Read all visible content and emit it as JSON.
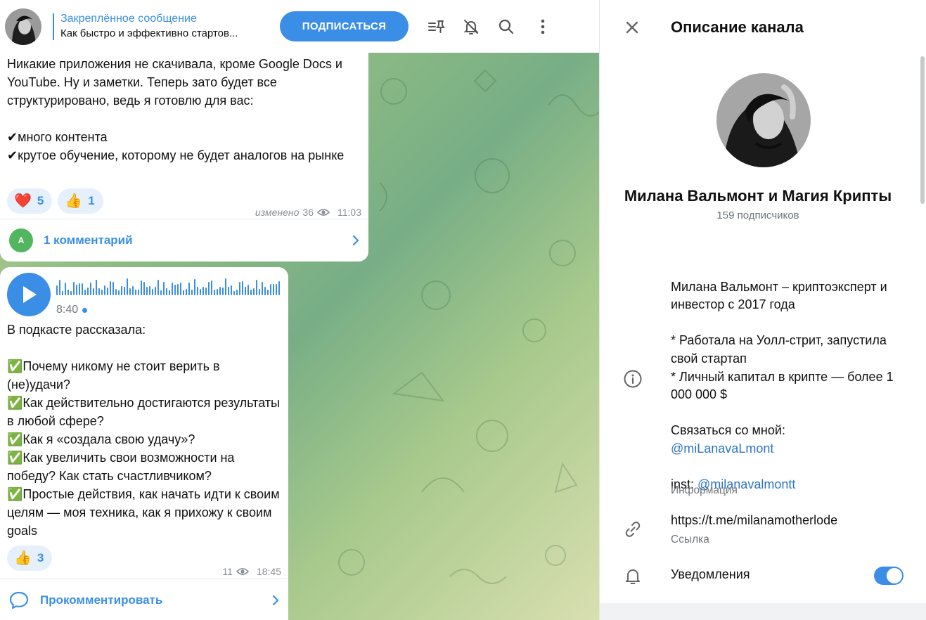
{
  "header": {
    "pinned_title": "Закреплённое сообщение",
    "pinned_text": "Как быстро и эффективно стартов...",
    "subscribe_label": "ПОДПИСАТЬСЯ",
    "icons": [
      "pinned-list-icon",
      "mute-bell-icon",
      "search-icon",
      "more-vertical-icon"
    ]
  },
  "messages": [
    {
      "text": "Никакие приложения не скачивала, кроме Google Docs и YouTube. Ну и заметки. Теперь зато будет все структурировано, ведь я готовлю для вас:\n\n✔много контента\n✔крутое обучение, которому не будет аналогов на рынке",
      "reactions": [
        {
          "emoji": "❤️",
          "count": "5"
        },
        {
          "emoji": "👍",
          "count": "1"
        }
      ],
      "edited": "изменено",
      "views": "36",
      "time": "11:03",
      "comment_avatar": "A",
      "comments_label": "1 комментарий"
    },
    {
      "duration": "8:40",
      "text": "В подкасте рассказала:\n\n✅Почему никому не стоит верить в (не)удачи?\n✅Как действительно достигаются результаты в любой сфере?\n✅Как я «создала свою удачу»?\n✅Как увеличить свои возможности на победу? Как стать счастливчиком?\n✅Простые действия, как начать идти к своим целям — моя техника, как я прихожу к своим goals",
      "reactions": [
        {
          "emoji": "👍",
          "count": "3"
        }
      ],
      "views": "11",
      "time": "18:45",
      "comment_label": "Прокомментировать"
    }
  ],
  "panel": {
    "title": "Описание канала",
    "channel_name": "Милана Вальмонт и Магия Крипты",
    "subscribers": "159 подписчиков",
    "desc_intro": "Милана Вальмонт – криптоэксперт и инвестор с 2017 года\n\n* Работала на Уолл-стрит, запустила свой стартап\n* Личный капитал в крипте — более 1 000 000 $\n\nСвязаться со мной:\n",
    "contact_handle": "@miLanavaLmont",
    "inst_prefix": "inst: ",
    "inst_handle": "@milanavalmontt",
    "info_label": "Информация",
    "link": "https://t.me/milanamotherlode",
    "link_label": "Ссылка",
    "notifications_label": "Уведомления",
    "notifications_on": true
  },
  "colors": {
    "accent": "#3a8ee6",
    "link": "#2c75c3",
    "muted": "#6f757a"
  }
}
